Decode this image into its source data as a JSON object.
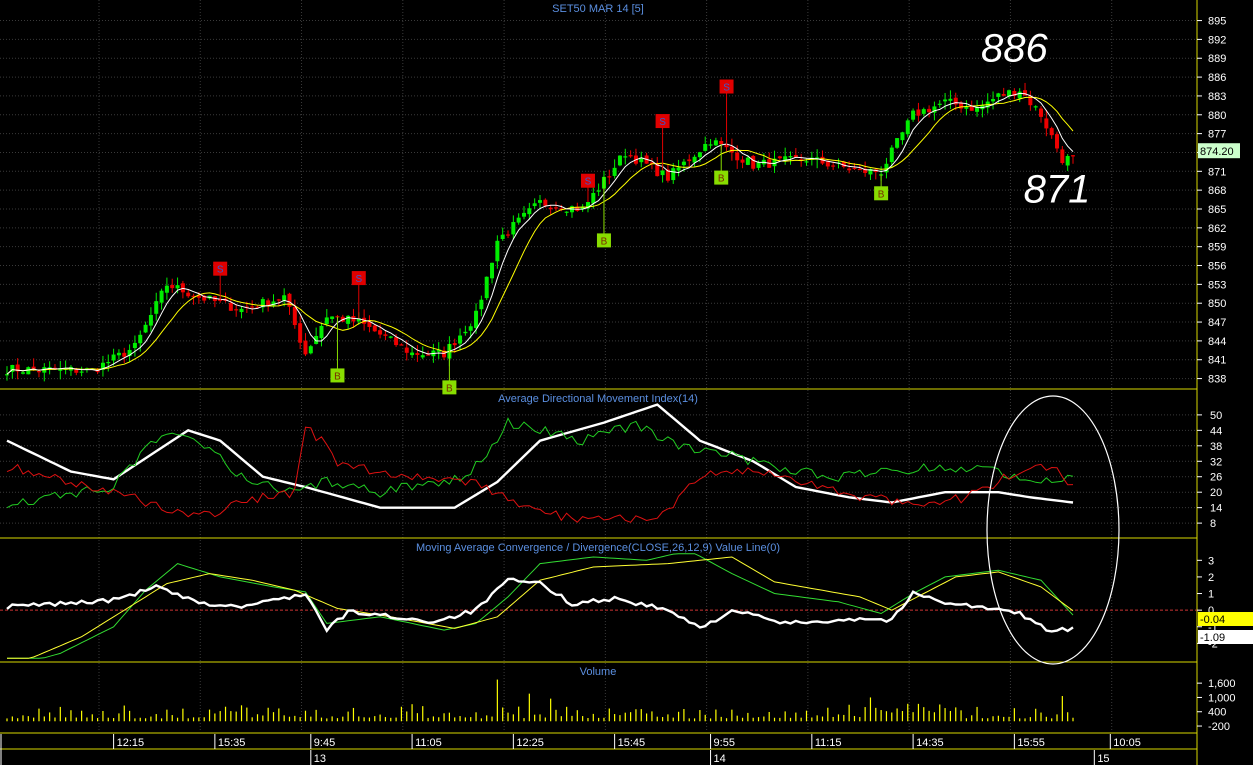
{
  "chart_data": [
    {
      "type": "candlestick",
      "title": "SET50 MAR 14   [5]",
      "y_ticks": [
        838,
        841,
        844,
        847,
        850,
        853,
        856,
        859,
        862,
        865,
        868,
        871,
        874,
        877,
        880,
        883,
        886,
        889,
        892,
        895
      ],
      "ylim": [
        836.5,
        897
      ],
      "last_value": "874.20",
      "annotations": [
        {
          "text": "886",
          "x_index": 189,
          "y": 888.5
        },
        {
          "text": "871",
          "x_index": 197,
          "y": 866
        }
      ],
      "signals": [
        {
          "label": "S",
          "x_index": 40,
          "y": 855.5
        },
        {
          "label": "S",
          "x_index": 66,
          "y": 854
        },
        {
          "label": "B",
          "x_index": 62,
          "y": 838.5
        },
        {
          "label": "B",
          "x_index": 83,
          "y": 836.6
        },
        {
          "label": "S",
          "x_index": 109,
          "y": 869.5
        },
        {
          "label": "B",
          "x_index": 112,
          "y": 860
        },
        {
          "label": "S",
          "x_index": 123,
          "y": 879
        },
        {
          "label": "B",
          "x_index": 134,
          "y": 870
        },
        {
          "label": "S",
          "x_index": 135,
          "y": 884.5
        },
        {
          "label": "B",
          "x_index": 164,
          "y": 867.5
        }
      ],
      "close_anchors": [
        [
          0,
          839.5
        ],
        [
          16,
          839.3
        ],
        [
          24,
          843
        ],
        [
          30,
          853
        ],
        [
          36,
          851
        ],
        [
          44,
          849
        ],
        [
          52,
          851
        ],
        [
          56,
          842
        ],
        [
          60,
          848
        ],
        [
          66,
          847
        ],
        [
          76,
          842
        ],
        [
          82,
          842
        ],
        [
          88,
          848
        ],
        [
          92,
          860
        ],
        [
          100,
          866
        ],
        [
          108,
          865
        ],
        [
          116,
          874
        ],
        [
          124,
          870
        ],
        [
          132,
          876
        ],
        [
          140,
          872
        ],
        [
          150,
          873
        ],
        [
          160,
          871
        ],
        [
          164,
          871
        ],
        [
          170,
          880
        ],
        [
          176,
          882
        ],
        [
          182,
          881
        ],
        [
          186,
          883
        ],
        [
          190,
          884
        ],
        [
          194,
          880
        ],
        [
          198,
          873
        ],
        [
          200,
          873
        ]
      ],
      "series": [
        {
          "name": "MA",
          "color": "#ffffff"
        },
        {
          "name": "MA",
          "color": "#ffff00"
        }
      ]
    },
    {
      "type": "line",
      "title": "Average Directional Movement Index(14)",
      "y_ticks": [
        8,
        14,
        20,
        26,
        32,
        38,
        44,
        50
      ],
      "ylim": [
        3,
        55
      ],
      "series": [
        {
          "name": "ADX",
          "color": "#ffffff",
          "anchors": [
            [
              0,
              40
            ],
            [
              12,
              28
            ],
            [
              20,
              25
            ],
            [
              34,
              44
            ],
            [
              40,
              40
            ],
            [
              48,
              26
            ],
            [
              56,
              22
            ],
            [
              70,
              14
            ],
            [
              84,
              14
            ],
            [
              92,
              24
            ],
            [
              100,
              40
            ],
            [
              112,
              47
            ],
            [
              122,
              54
            ],
            [
              130,
              40
            ],
            [
              140,
              32
            ],
            [
              148,
              22
            ],
            [
              158,
              18
            ],
            [
              166,
              16
            ],
            [
              176,
              20
            ],
            [
              186,
              20
            ],
            [
              192,
              18
            ],
            [
              200,
              16
            ]
          ]
        },
        {
          "name": "+DI",
          "color": "#22cc22",
          "anchors": [
            [
              0,
              16
            ],
            [
              8,
              18
            ],
            [
              20,
              22
            ],
            [
              24,
              32
            ],
            [
              30,
              44
            ],
            [
              36,
              40
            ],
            [
              44,
              26
            ],
            [
              52,
              20
            ],
            [
              60,
              24
            ],
            [
              70,
              20
            ],
            [
              80,
              24
            ],
            [
              86,
              26
            ],
            [
              90,
              34
            ],
            [
              94,
              47
            ],
            [
              100,
              44
            ],
            [
              108,
              40
            ],
            [
              118,
              46
            ],
            [
              124,
              40
            ],
            [
              130,
              36
            ],
            [
              136,
              34
            ],
            [
              144,
              30
            ],
            [
              156,
              26
            ],
            [
              166,
              28
            ],
            [
              176,
              30
            ],
            [
              186,
              28
            ],
            [
              196,
              24
            ],
            [
              200,
              28
            ]
          ]
        },
        {
          "name": "-DI",
          "color": "#dd1111",
          "anchors": [
            [
              0,
              30
            ],
            [
              8,
              26
            ],
            [
              20,
              20
            ],
            [
              30,
              14
            ],
            [
              36,
              10
            ],
            [
              44,
              16
            ],
            [
              54,
              20
            ],
            [
              56,
              47
            ],
            [
              62,
              32
            ],
            [
              68,
              28
            ],
            [
              80,
              26
            ],
            [
              90,
              22
            ],
            [
              96,
              14
            ],
            [
              106,
              10
            ],
            [
              116,
              10
            ],
            [
              124,
              12
            ],
            [
              130,
              26
            ],
            [
              140,
              28
            ],
            [
              150,
              24
            ],
            [
              160,
              18
            ],
            [
              170,
              16
            ],
            [
              180,
              18
            ],
            [
              188,
              26
            ],
            [
              196,
              30
            ],
            [
              200,
              22
            ]
          ]
        }
      ]
    },
    {
      "type": "line",
      "title": "Moving Average Convergence / Divergence(CLOSE,26,12,9) Value Line(0)",
      "y_ticks": [
        3,
        2,
        1,
        0,
        -1,
        -2
      ],
      "ylim": [
        -3,
        3.5
      ],
      "value_labels": [
        "-0.04",
        "-1.09"
      ],
      "series": [
        {
          "name": "MACD",
          "color": "#ffffff",
          "anchors": [
            [
              0,
              0.2
            ],
            [
              10,
              0.4
            ],
            [
              20,
              0.6
            ],
            [
              28,
              1.4
            ],
            [
              36,
              0.4
            ],
            [
              44,
              0.2
            ],
            [
              56,
              1.0
            ],
            [
              60,
              -1.2
            ],
            [
              64,
              -0.1
            ],
            [
              70,
              -0.3
            ],
            [
              80,
              -0.7
            ],
            [
              88,
              0.0
            ],
            [
              94,
              1.8
            ],
            [
              100,
              1.6
            ],
            [
              106,
              0.4
            ],
            [
              114,
              0.7
            ],
            [
              124,
              0.0
            ],
            [
              130,
              -1.1
            ],
            [
              136,
              0.0
            ],
            [
              146,
              -0.8
            ],
            [
              160,
              -0.5
            ],
            [
              166,
              -0.6
            ],
            [
              170,
              1.0
            ],
            [
              176,
              0.5
            ],
            [
              184,
              0.1
            ],
            [
              190,
              -0.2
            ],
            [
              196,
              -1.3
            ],
            [
              200,
              -1.09
            ]
          ]
        },
        {
          "name": "Signal",
          "color": "#ffff33",
          "anchors": [
            [
              0,
              -3.5
            ],
            [
              14,
              -1.6
            ],
            [
              22,
              0
            ],
            [
              30,
              1.6
            ],
            [
              38,
              2.2
            ],
            [
              46,
              1.8
            ],
            [
              54,
              1.2
            ],
            [
              62,
              0.1
            ],
            [
              72,
              -0.4
            ],
            [
              84,
              -1.1
            ],
            [
              92,
              -0.4
            ],
            [
              100,
              1.8
            ],
            [
              110,
              2.6
            ],
            [
              124,
              2.8
            ],
            [
              136,
              3.2
            ],
            [
              144,
              1.7
            ],
            [
              160,
              0.8
            ],
            [
              166,
              0.0
            ],
            [
              172,
              1.0
            ],
            [
              178,
              2.0
            ],
            [
              186,
              2.3
            ],
            [
              194,
              1.4
            ],
            [
              200,
              -0.04
            ]
          ]
        },
        {
          "name": "MACD",
          "color": "#33dd33",
          "anchors": [
            [
              0,
              -3.5
            ],
            [
              10,
              -2.6
            ],
            [
              20,
              -1.0
            ],
            [
              26,
              1.2
            ],
            [
              32,
              2.8
            ],
            [
              40,
              2.0
            ],
            [
              50,
              1.4
            ],
            [
              56,
              1.1
            ],
            [
              60,
              -0.8
            ],
            [
              70,
              -0.4
            ],
            [
              82,
              -1.2
            ],
            [
              88,
              -0.8
            ],
            [
              94,
              0.8
            ],
            [
              100,
              2.8
            ],
            [
              110,
              3.2
            ],
            [
              120,
              3.0
            ],
            [
              128,
              3.6
            ],
            [
              136,
              2.2
            ],
            [
              144,
              1.0
            ],
            [
              156,
              0.5
            ],
            [
              164,
              -0.2
            ],
            [
              170,
              1.0
            ],
            [
              176,
              2.0
            ],
            [
              186,
              2.4
            ],
            [
              194,
              1.8
            ],
            [
              200,
              -0.3
            ]
          ]
        }
      ]
    },
    {
      "type": "bar",
      "title": "Volume",
      "y_ticks": [
        "1,600",
        "1,000",
        "400",
        "-200"
      ],
      "ylim": [
        -450,
        1900
      ],
      "spikes": [
        [
          92,
          1750
        ],
        [
          98,
          1160
        ],
        [
          102,
          950
        ],
        [
          162,
          1000
        ],
        [
          198,
          1060
        ]
      ],
      "series": [
        {
          "name": "Volume",
          "color": "#ffff00"
        }
      ]
    }
  ],
  "x_axis": {
    "time_labels": [
      {
        "text": "12:15",
        "x_index": 20
      },
      {
        "text": "15:35",
        "x_index": 39
      },
      {
        "text": "9:45",
        "x_index": 57
      },
      {
        "text": "11:05",
        "x_index": 76
      },
      {
        "text": "12:25",
        "x_index": 95
      },
      {
        "text": "15:45",
        "x_index": 114
      },
      {
        "text": "9:55",
        "x_index": 132
      },
      {
        "text": "11:15",
        "x_index": 151
      },
      {
        "text": "14:35",
        "x_index": 170
      },
      {
        "text": "15:55",
        "x_index": 189
      },
      {
        "text": "10:05",
        "x_index": 207
      }
    ],
    "date_labels": [
      {
        "text": "13",
        "x_index": 57
      },
      {
        "text": "14",
        "x_index": 132
      },
      {
        "text": "15",
        "x_index": 204
      }
    ]
  },
  "colors": {
    "background": "#000000",
    "grid": "#3a3a3a",
    "divider": "#d8d800",
    "up": "#00ee00",
    "down": "#ee0000",
    "title_text": "#5b8fe0",
    "axis_text": "#ffffff",
    "sell_tag": "#e00000",
    "buy_tag": "#88dd00"
  }
}
